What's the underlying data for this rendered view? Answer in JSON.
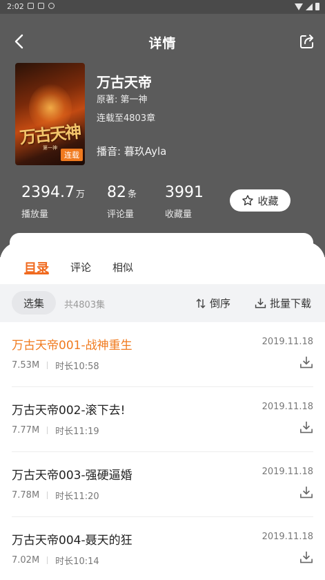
{
  "status_bar": {
    "time": "2:02"
  },
  "nav": {
    "title": "详情"
  },
  "book": {
    "cover_title": "万古天神",
    "cover_author": "第一神",
    "cover_badge": "连载",
    "title": "万古天帝",
    "origin": "原著: 第一神",
    "progress": "连载至4803章",
    "narrator": "播音: 暮玖Ayla"
  },
  "stats": [
    {
      "value": "2394.7",
      "unit": "万",
      "label": "播放量"
    },
    {
      "value": "82",
      "unit": "条",
      "label": "评论量"
    },
    {
      "value": "3991",
      "unit": "",
      "label": "收藏量"
    }
  ],
  "collect_button": "收藏",
  "tabs": [
    {
      "label": "目录",
      "active": true
    },
    {
      "label": "评论",
      "active": false
    },
    {
      "label": "相似",
      "active": false
    }
  ],
  "toolbar": {
    "select_label": "选集",
    "total": "共4803集",
    "sort_label": "倒序",
    "batch_download_label": "批量下载"
  },
  "episodes": [
    {
      "title": "万古天帝001-战神重生",
      "date": "2019.11.18",
      "size": "7.53M",
      "duration": "时长10:58",
      "playing": true
    },
    {
      "title": "万古天帝002-滚下去!",
      "date": "2019.11.18",
      "size": "7.77M",
      "duration": "时长11:19",
      "playing": false
    },
    {
      "title": "万古天帝003-强硬逼婚",
      "date": "2019.11.18",
      "size": "7.78M",
      "duration": "时长11:20",
      "playing": false
    },
    {
      "title": "万古天帝004-聂天的狂",
      "date": "2019.11.18",
      "size": "7.02M",
      "duration": "时长10:14",
      "playing": false
    }
  ],
  "colors": {
    "accent": "#f06a1f",
    "header_bg": "#5b5b5b"
  }
}
